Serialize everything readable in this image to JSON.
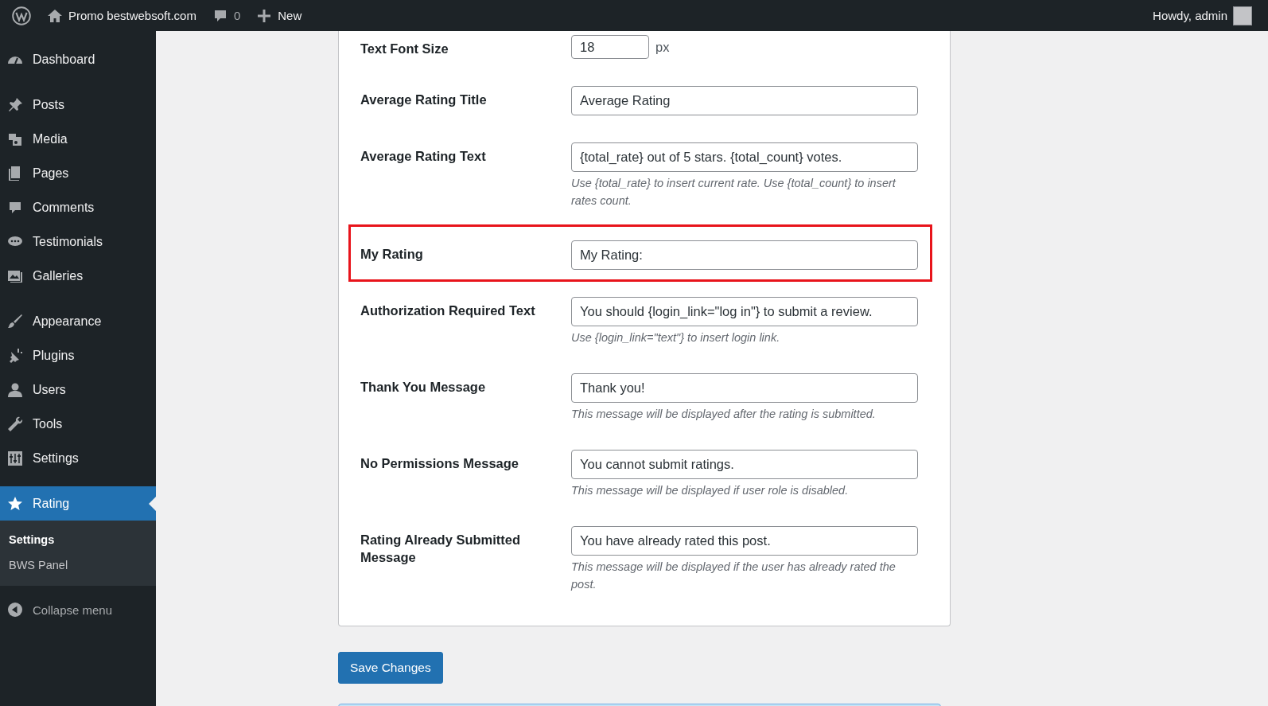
{
  "admin_bar": {
    "site_name": "Promo bestwebsoft.com",
    "comments_count": "0",
    "new_label": "New",
    "greeting": "Howdy, admin"
  },
  "sidebar": {
    "groups": [
      [
        {
          "label": "Dashboard",
          "selected": false
        }
      ],
      [
        {
          "label": "Posts",
          "selected": false
        },
        {
          "label": "Media",
          "selected": false
        },
        {
          "label": "Pages",
          "selected": false
        },
        {
          "label": "Comments",
          "selected": false
        },
        {
          "label": "Testimonials",
          "selected": false
        },
        {
          "label": "Galleries",
          "selected": false
        }
      ],
      [
        {
          "label": "Appearance",
          "selected": false
        },
        {
          "label": "Plugins",
          "selected": false
        },
        {
          "label": "Users",
          "selected": false
        },
        {
          "label": "Tools",
          "selected": false
        },
        {
          "label": "Settings",
          "selected": false
        }
      ],
      [
        {
          "label": "Rating",
          "selected": true,
          "submenu": [
            {
              "label": "Settings",
              "selected": true
            },
            {
              "label": "BWS Panel",
              "selected": false
            }
          ]
        }
      ]
    ],
    "collapse_label": "Collapse menu"
  },
  "form": {
    "rows": [
      {
        "label": "Text Font Size",
        "kind": "number",
        "value": "18",
        "unit": "px",
        "highlighted": false
      },
      {
        "label": "Average Rating Title",
        "kind": "text",
        "value": "Average Rating",
        "highlighted": false
      },
      {
        "label": "Average Rating Text",
        "kind": "text",
        "value": "{total_rate} out of 5 stars. {total_count} votes.",
        "hint": "Use {total_rate} to insert current rate. Use {total_count} to insert rates count.",
        "highlighted": false
      },
      {
        "label": "My Rating",
        "kind": "text",
        "value": "My Rating:",
        "highlighted": true
      },
      {
        "label": "Authorization Required Text",
        "kind": "text",
        "value": "You should {login_link=\"log in\"} to submit a review.",
        "hint": "Use {login_link=\"text\"} to insert login link.",
        "highlighted": false
      },
      {
        "label": "Thank You Message",
        "kind": "text",
        "value": "Thank you!",
        "hint": "This message will be displayed after the rating is submitted.",
        "highlighted": false
      },
      {
        "label": "No Permissions Message",
        "kind": "text",
        "value": "You cannot submit ratings.",
        "hint": "This message will be displayed if user role is disabled.",
        "highlighted": false
      },
      {
        "label": "Rating Already Submitted Message",
        "kind": "text",
        "value": "You have already rated this post.",
        "hint": "This message will be displayed if the user has already rated the post.",
        "highlighted": false
      }
    ]
  },
  "save_button": "Save Changes"
}
